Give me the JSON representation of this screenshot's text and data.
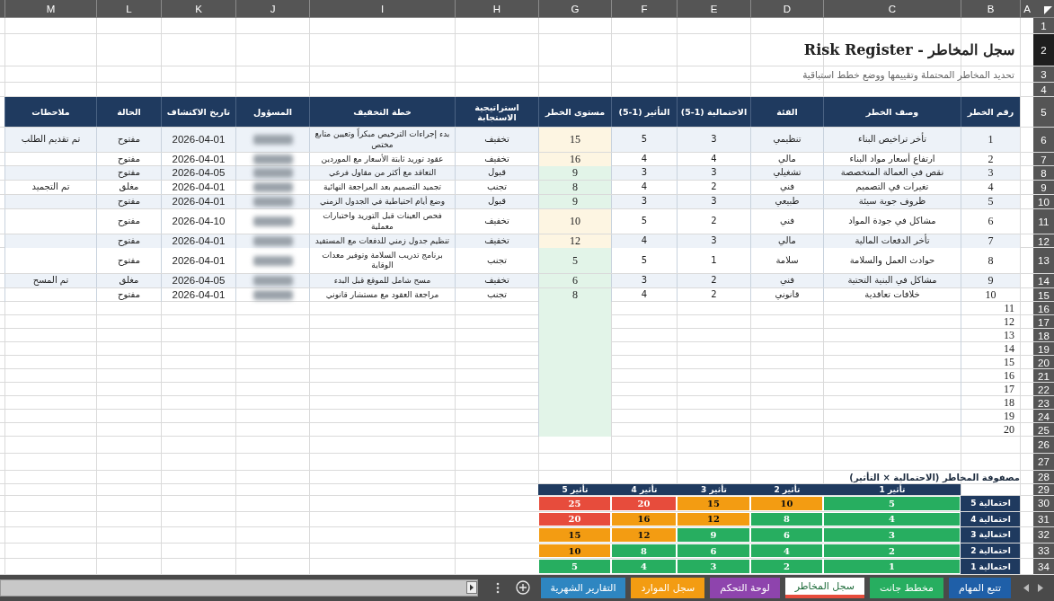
{
  "columns": [
    "A",
    "B",
    "C",
    "D",
    "E",
    "F",
    "G",
    "H",
    "I",
    "J",
    "K",
    "L",
    "M"
  ],
  "row_headers": [
    {
      "label": "1",
      "selected": false
    },
    {
      "label": "2",
      "selected": true
    },
    {
      "label": "3",
      "selected": false
    },
    {
      "label": "4",
      "selected": false
    },
    {
      "label": "5",
      "selected": false
    },
    {
      "label": "6",
      "selected": false
    },
    {
      "label": "7",
      "selected": false
    },
    {
      "label": "8",
      "selected": false
    },
    {
      "label": "9",
      "selected": false
    },
    {
      "label": "10",
      "selected": false
    },
    {
      "label": "11",
      "selected": false
    },
    {
      "label": "12",
      "selected": false
    },
    {
      "label": "13",
      "selected": false
    },
    {
      "label": "14",
      "selected": false
    },
    {
      "label": "15",
      "selected": false
    },
    {
      "label": "16",
      "selected": false
    },
    {
      "label": "17",
      "selected": false
    },
    {
      "label": "18",
      "selected": false
    },
    {
      "label": "19",
      "selected": false
    },
    {
      "label": "20",
      "selected": false
    },
    {
      "label": "21",
      "selected": false
    },
    {
      "label": "22",
      "selected": false
    },
    {
      "label": "23",
      "selected": false
    },
    {
      "label": "24",
      "selected": false
    },
    {
      "label": "25",
      "selected": false
    },
    {
      "label": "26",
      "selected": false
    },
    {
      "label": "27",
      "selected": false
    },
    {
      "label": "28",
      "selected": false
    },
    {
      "label": "29",
      "selected": false
    },
    {
      "label": "30",
      "selected": false
    },
    {
      "label": "31",
      "selected": false
    },
    {
      "label": "32",
      "selected": false
    },
    {
      "label": "33",
      "selected": false
    },
    {
      "label": "34",
      "selected": false
    }
  ],
  "title": "سجل المخاطر - Risk Register",
  "subtitle": "تحديد المخاطر المحتملة وتقييمها ووضع خطط استباقية",
  "table": {
    "columns": [
      "رقم الخطر",
      "وصف الخطر",
      "الفئة",
      "الاحتمالية (1-5)",
      "التأثير (1-5)",
      "مستوى الخطر",
      "استراتيجية الاستجابة",
      "خطة التخفيف",
      "المسؤول",
      "تاريخ الاكتشاف",
      "الحالة",
      "ملاحظات"
    ],
    "rows": [
      {
        "number": "1",
        "description": "تأخر تراخيص البناء",
        "category": "تنظيمي",
        "probability": "3",
        "impact": "5",
        "risk_level": "15",
        "color": "#fdf5e2",
        "strategy": "تخفيف",
        "mitigation": "بدء إجراءات الترخيص مبكراً وتعيين متابع مختص",
        "discovered": "2026-04-01",
        "status": "مفتوح",
        "notes": "تم تقديم الطلب"
      },
      {
        "number": "2",
        "description": "ارتفاع أسعار مواد البناء",
        "category": "مالي",
        "probability": "4",
        "impact": "4",
        "risk_level": "16",
        "color": "#fdf5e2",
        "strategy": "تخفيف",
        "mitigation": "عقود توريد ثابتة الأسعار مع الموردين",
        "discovered": "2026-04-01",
        "status": "مفتوح"
      },
      {
        "number": "3",
        "description": "نقص في العمالة المتخصصة",
        "category": "تشغيلي",
        "probability": "3",
        "impact": "3",
        "risk_level": "9",
        "color": "#e2f4e8",
        "strategy": "قبول",
        "mitigation": "التعاقد مع أكثر من مقاول فرعي",
        "discovered": "2026-04-05",
        "status": "مفتوح"
      },
      {
        "number": "4",
        "description": "تغيرات في التصميم",
        "category": "فني",
        "probability": "2",
        "impact": "4",
        "risk_level": "8",
        "color": "#e2f4e8",
        "strategy": "تجنب",
        "mitigation": "تجميد التصميم بعد المراجعة النهائية",
        "discovered": "2026-04-01",
        "status": "مغلق",
        "notes": "تم التجميد"
      },
      {
        "number": "5",
        "description": "ظروف جوية سيئة",
        "category": "طبيعي",
        "probability": "3",
        "impact": "3",
        "risk_level": "9",
        "color": "#e2f4e8",
        "strategy": "قبول",
        "mitigation": "وضع أيام احتياطية في الجدول الزمني",
        "discovered": "2026-04-01",
        "status": "مفتوح"
      },
      {
        "number": "6",
        "description": "مشاكل في جودة المواد",
        "category": "فني",
        "probability": "2",
        "impact": "5",
        "risk_level": "10",
        "color": "#fdf5e2",
        "strategy": "تخفيف",
        "mitigation": "فحص العينات قبل التوريد واختبارات معملية",
        "discovered": "2026-04-10",
        "status": "مفتوح"
      },
      {
        "number": "7",
        "description": "تأخر الدفعات المالية",
        "category": "مالي",
        "probability": "3",
        "impact": "4",
        "risk_level": "12",
        "color": "#fdf5e2",
        "strategy": "تخفيف",
        "mitigation": "تنظيم جدول زمني للدفعات مع المستفيد",
        "discovered": "2026-04-01",
        "status": "مفتوح"
      },
      {
        "number": "8",
        "description": "حوادث العمل والسلامة",
        "category": "سلامة",
        "probability": "1",
        "impact": "5",
        "risk_level": "5",
        "color": "#e2f4e8",
        "strategy": "تجنب",
        "mitigation": "برنامج تدريب السلامة وتوفير معدات الوقاية",
        "discovered": "2026-04-01",
        "status": "مفتوح"
      },
      {
        "number": "9",
        "description": "مشاكل في البنية التحتية",
        "category": "فني",
        "probability": "2",
        "impact": "3",
        "risk_level": "6",
        "color": "#e2f4e8",
        "strategy": "تخفيف",
        "mitigation": "مسح شامل للموقع قبل البدء",
        "discovered": "2026-04-05",
        "status": "مغلق",
        "notes": "تم المسح"
      },
      {
        "number": "10",
        "description": "خلافات تعاقدية",
        "category": "قانوني",
        "probability": "2",
        "impact": "4",
        "risk_level": "8",
        "color": "#e2f4e8",
        "strategy": "تجنب",
        "mitigation": "مراجعة العقود مع مستشار قانوني",
        "discovered": "2026-04-01",
        "status": "مفتوح"
      }
    ],
    "empty_rows": [
      "11",
      "12",
      "13",
      "14",
      "15",
      "16",
      "17",
      "18",
      "19",
      "20"
    ]
  },
  "matrix": {
    "title": "مصفوفة المخاطر (الاحتمالية × التأثير)",
    "columns": [
      "تأثير 1",
      "تأثير 2",
      "تأثير 3",
      "تأثير 4",
      "تأثير 5"
    ],
    "rows": [
      {
        "label": "احتمالية 5",
        "cells": [
          {
            "value": "5",
            "color": "#27ae60"
          },
          {
            "value": "10",
            "color": "#f39c12"
          },
          {
            "value": "15",
            "color": "#f39c12"
          },
          {
            "value": "20",
            "color": "#e74c3c"
          },
          {
            "value": "25",
            "color": "#e74c3c"
          }
        ]
      },
      {
        "label": "احتمالية 4",
        "cells": [
          {
            "value": "4",
            "color": "#27ae60"
          },
          {
            "value": "8",
            "color": "#27ae60"
          },
          {
            "value": "12",
            "color": "#f39c12"
          },
          {
            "value": "16",
            "color": "#f39c12"
          },
          {
            "value": "20",
            "color": "#e74c3c"
          }
        ]
      },
      {
        "label": "احتمالية 3",
        "cells": [
          {
            "value": "3",
            "color": "#27ae60"
          },
          {
            "value": "6",
            "color": "#27ae60"
          },
          {
            "value": "9",
            "color": "#27ae60"
          },
          {
            "value": "12",
            "color": "#f39c12"
          },
          {
            "value": "15",
            "color": "#f39c12"
          }
        ]
      },
      {
        "label": "احتمالية 2",
        "cells": [
          {
            "value": "2",
            "color": "#27ae60"
          },
          {
            "value": "4",
            "color": "#27ae60"
          },
          {
            "value": "6",
            "color": "#27ae60"
          },
          {
            "value": "8",
            "color": "#27ae60"
          },
          {
            "value": "10",
            "color": "#f39c12"
          }
        ]
      },
      {
        "label": "احتمالية 1",
        "cells": [
          {
            "value": "1",
            "color": "#27ae60"
          },
          {
            "value": "2",
            "color": "#27ae60"
          },
          {
            "value": "3",
            "color": "#27ae60"
          },
          {
            "value": "4",
            "color": "#27ae60"
          },
          {
            "value": "5",
            "color": "#27ae60"
          }
        ]
      }
    ]
  },
  "tabs": [
    {
      "label": "تتبع المهام",
      "color": "#1f5fa8",
      "selected": false
    },
    {
      "label": "مخطط جانت",
      "color": "#27ae60",
      "selected": false
    },
    {
      "label": "سجل المخاطر",
      "color": "#e74c3c",
      "selected": true
    },
    {
      "label": "لوحة التحكم",
      "color": "#8e44ad",
      "selected": false
    },
    {
      "label": "سجل الموارد",
      "color": "#f39c12",
      "selected": false
    },
    {
      "label": "التقارير الشهرية",
      "color": "#2e86c1",
      "selected": false
    }
  ]
}
